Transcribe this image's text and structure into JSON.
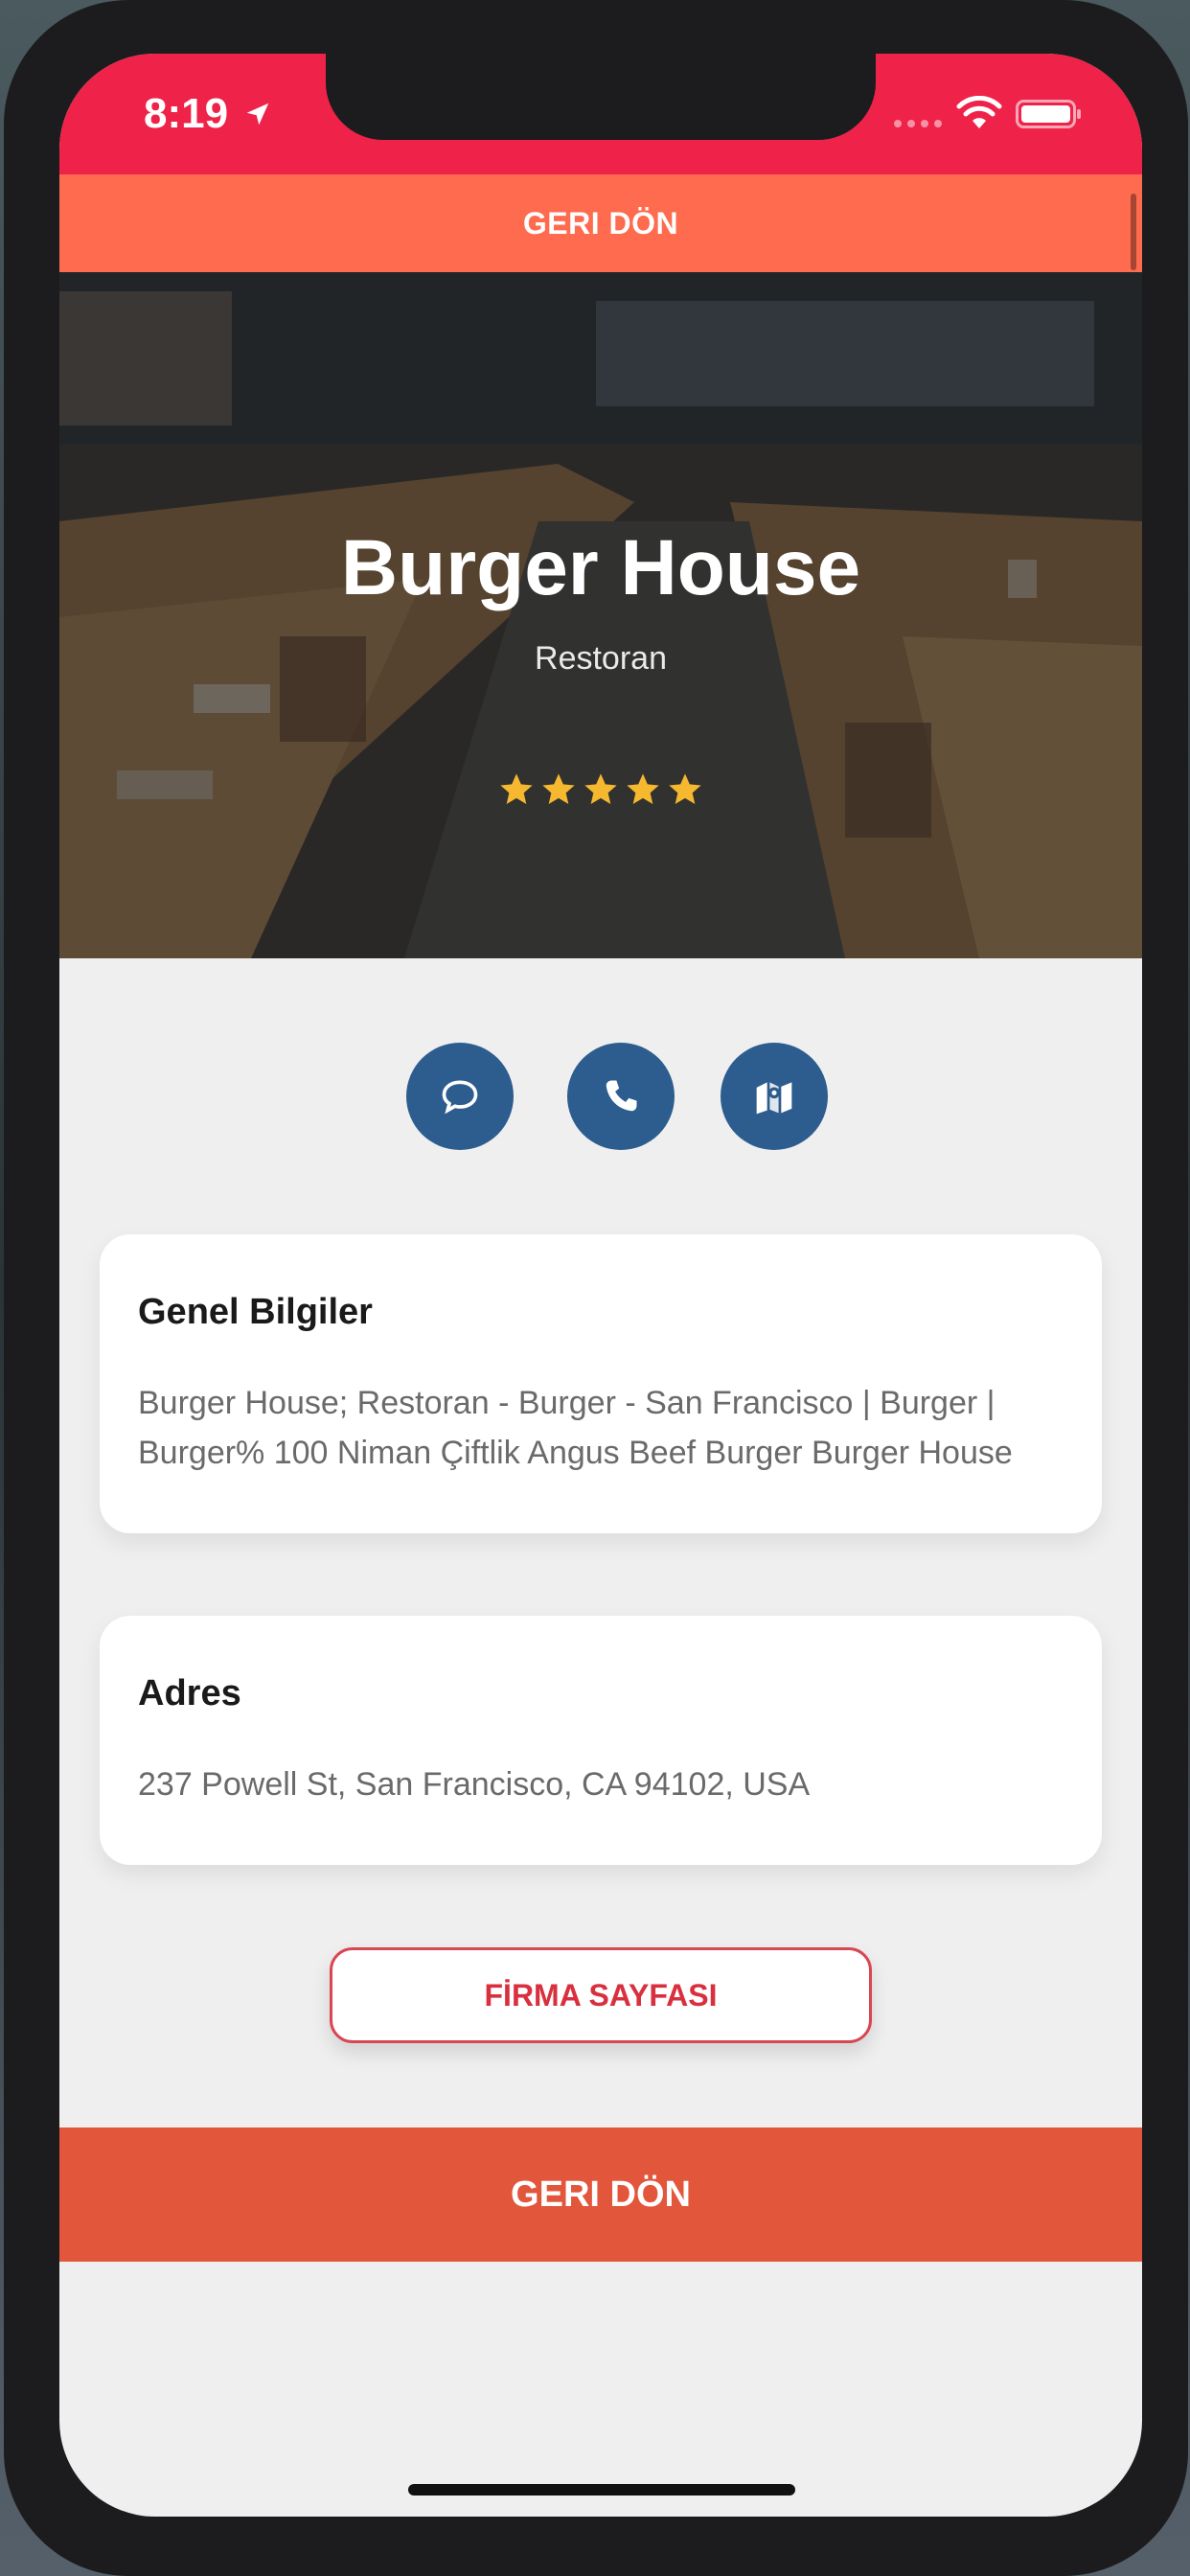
{
  "status_bar": {
    "time": "8:19",
    "background_color": "#ef2249"
  },
  "top_back_bar": {
    "label": "GERI DÖN",
    "color": "#fe6b4e"
  },
  "hero": {
    "title": "Burger House",
    "subtitle": "Restoran",
    "rating": 5,
    "rating_max": 5,
    "star_color": "#f5b82e"
  },
  "actions": [
    {
      "icon": "chat-bubble-icon"
    },
    {
      "icon": "phone-icon"
    },
    {
      "icon": "map-icon"
    }
  ],
  "general_info": {
    "title": "Genel Bilgiler",
    "text": "Burger House; Restoran - Burger - San Francisco | Burger | Burger% 100 Niman Çiftlik Angus Beef Burger Burger House"
  },
  "address": {
    "title": "Adres",
    "text": "237 Powell St, San Francisco, CA 94102, USA"
  },
  "firma_button": {
    "label": "FİRMA SAYFASI"
  },
  "bottom_back_button": {
    "label": "GERI DÖN",
    "color": "#e2573c"
  }
}
